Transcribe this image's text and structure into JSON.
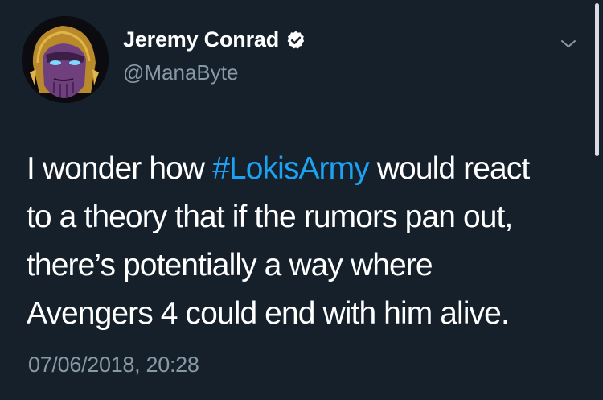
{
  "tweet": {
    "author": {
      "display_name": "Jeremy Conrad",
      "handle": "@ManaByte",
      "verified": true,
      "avatar_icon": "thanos-avatar"
    },
    "text": {
      "line1_before": "I wonder how ",
      "hashtag": "#LokisArmy",
      "line1_after": " would react",
      "line2": "to a theory that if the rumors pan out,",
      "line3": "there’s potentially a way where",
      "line4": "Avengers 4 could end with him alive."
    },
    "timestamp": "07/06/2018, 20:28",
    "menu_icon": "chevron-down-icon"
  },
  "colors": {
    "background": "#15202b",
    "text": "#ffffff",
    "secondary_text": "#8899a6",
    "link": "#1da1f2"
  }
}
